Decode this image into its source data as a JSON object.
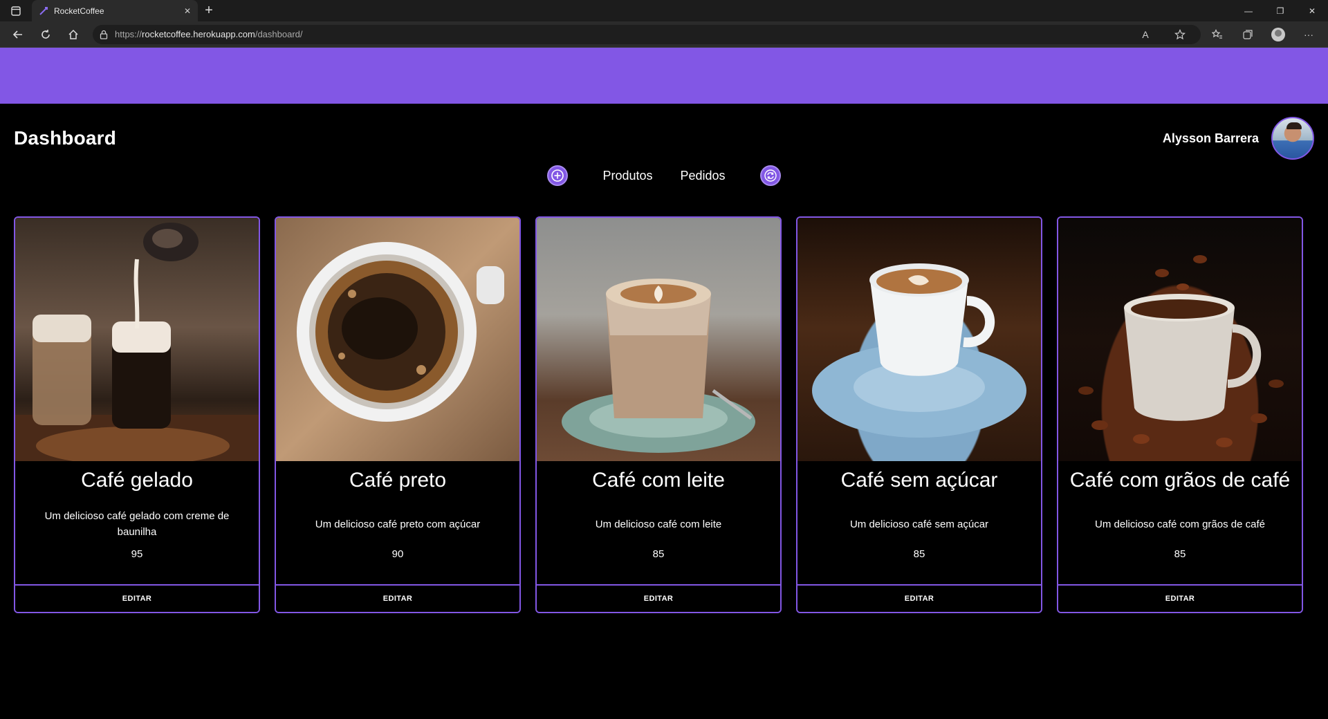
{
  "browser": {
    "tab_title": "RocketCoffee",
    "url_prefix": "https://",
    "url_host": "rocketcoffee.herokuapp.com",
    "url_path": "/dashboard/",
    "new_tab_glyph": "+",
    "min_glyph": "—",
    "restore_glyph": "❐",
    "close_glyph": "✕",
    "more_glyph": "···",
    "read_aloud_glyph": "A"
  },
  "header": {
    "title": "Dashboard",
    "user_name": "Alysson Barrera"
  },
  "menu": {
    "items": [
      "Produtos",
      "Pedidos"
    ]
  },
  "products": [
    {
      "name": "Café gelado",
      "description": "Um delicioso café gelado com creme de baunilha",
      "price": "95",
      "button": "EDITAR"
    },
    {
      "name": "Café preto",
      "description": "Um delicioso café preto com açúcar",
      "price": "90",
      "button": "EDITAR"
    },
    {
      "name": "Café com leite",
      "description": "Um delicioso café com leite",
      "price": "85",
      "button": "EDITAR"
    },
    {
      "name": "Café sem açúcar",
      "description": "Um delicioso café sem açúcar",
      "price": "85",
      "button": "EDITAR"
    },
    {
      "name": "Café com grãos de café",
      "description": "Um delicioso café com grãos de café",
      "price": "85",
      "button": "EDITAR"
    }
  ],
  "colors": {
    "accent": "#8257e5",
    "background": "#000000"
  }
}
